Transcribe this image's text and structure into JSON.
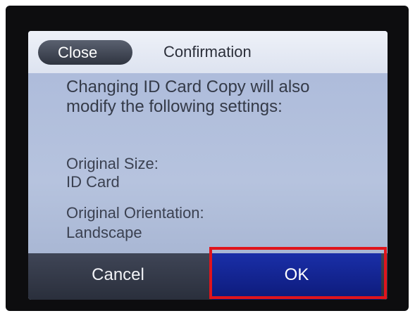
{
  "header": {
    "close_label": "Close",
    "title": "Confirmation"
  },
  "message": {
    "line1": "Changing ID Card Copy will also",
    "line2": "modify the following settings:"
  },
  "settings": [
    {
      "name": "Original Size:",
      "value": "ID Card"
    },
    {
      "name": "Original Orientation:",
      "value": "Landscape"
    }
  ],
  "buttons": {
    "cancel_label": "Cancel",
    "ok_label": "OK"
  },
  "colors": {
    "highlight": "#e0141c",
    "ok_button": "#1a2fa8",
    "screen_background": "#b6c3de"
  }
}
